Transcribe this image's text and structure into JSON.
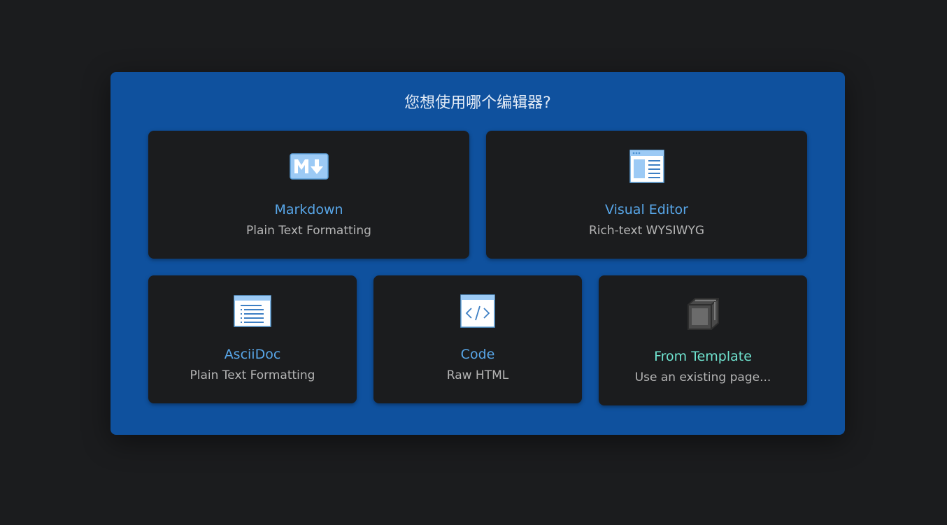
{
  "dialog": {
    "title": "您想使用哪个编辑器?"
  },
  "editors": [
    {
      "label": "Markdown",
      "description": "Plain Text Formatting",
      "icon": "markdown-icon"
    },
    {
      "label": "Visual Editor",
      "description": "Rich-text WYSIWYG",
      "icon": "visual-editor-icon"
    },
    {
      "label": "AsciiDoc",
      "description": "Plain Text Formatting",
      "icon": "asciidoc-icon"
    },
    {
      "label": "Code",
      "description": "Raw HTML",
      "icon": "code-icon"
    },
    {
      "label": "From Template",
      "description": "Use an existing page...",
      "icon": "template-cube-icon"
    }
  ],
  "colors": {
    "background": "#1b1c1e",
    "dialog": "#0f519e",
    "card": "#1b1c1e",
    "label": "#58a6e8",
    "template_label": "#6fe3cf",
    "description": "#b5b5b5"
  }
}
